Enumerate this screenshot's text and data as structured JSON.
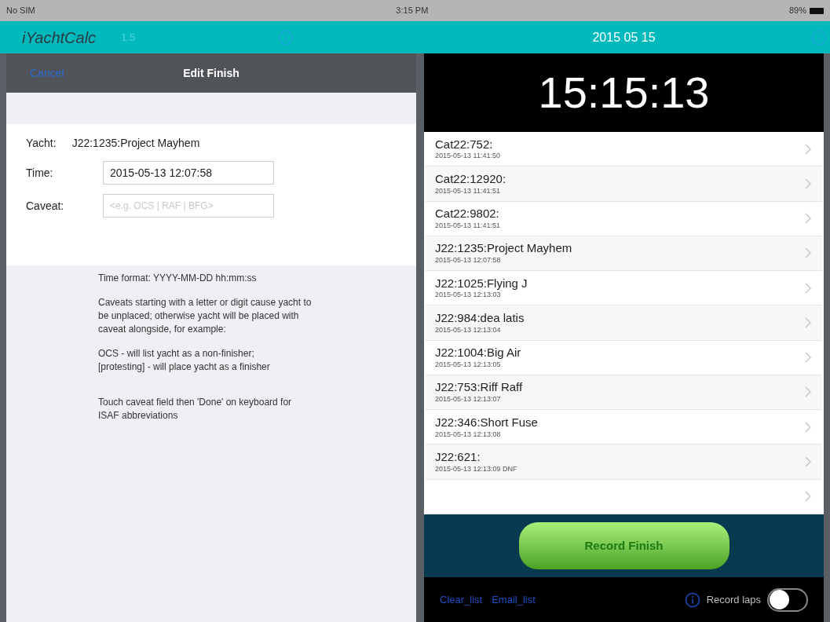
{
  "status_bar": {
    "carrier": "No SIM",
    "time": "3:15 PM",
    "battery": "89%"
  },
  "app_bar": {
    "title": "iYachtCalc",
    "version": "1.5",
    "date": "2015 05 15"
  },
  "edit_panel": {
    "cancel": "Cancel",
    "title": "Edit Finish",
    "yacht_label": "Yacht:",
    "yacht": "J22:1235:Project Mayhem",
    "time_label": "Time:",
    "time_value": "2015-05-13 12:07:58",
    "caveat_label": "Caveat:",
    "caveat_placeholder": "<e.g. OCS | RAF | BFG>",
    "notes": [
      "Time format: YYYY-MM-DD hh:mm:ss",
      "Caveats starting with a letter or digit cause yacht to be unplaced; otherwise yacht will be placed with caveat alongside, for example:",
      "OCS - will list yacht as a non-finisher;\n[protesting] - will place yacht as a finisher",
      "Touch caveat field then 'Done' on keyboard for ISAF abbreviations"
    ]
  },
  "clock": "15:15:13",
  "finishes": [
    {
      "kind": "entry",
      "name": "Cat22:752:",
      "time": "2015-05-13 11:41:50"
    },
    {
      "kind": "entry",
      "name": "Cat22:12920:",
      "time": "2015-05-13 11:41:51"
    },
    {
      "kind": "entry",
      "name": "Cat22:9802:",
      "time": "2015-05-13 11:41:51"
    },
    {
      "kind": "entry",
      "name": "J22:1235:Project Mayhem",
      "time": "2015-05-13 12:07:58"
    },
    {
      "kind": "entry",
      "name": "J22:1025:Flying J",
      "time": "2015-05-13 12:13:03"
    },
    {
      "kind": "entry",
      "name": "J22:984:dea latis",
      "time": "2015-05-13 12:13:04"
    },
    {
      "kind": "entry",
      "name": "J22:1004:Big Air",
      "time": "2015-05-13 12:13:05"
    },
    {
      "kind": "entry",
      "name": "J22:753:Riff Raff",
      "time": "2015-05-13 12:13:07"
    },
    {
      "kind": "entry",
      "name": "J22:346:Short Fuse",
      "time": "2015-05-13 12:13:08"
    },
    {
      "kind": "entry",
      "name": "J22:621:",
      "time": "2015-05-13 12:13:09 DNF"
    },
    {
      "kind": "blank"
    }
  ],
  "record_button": "Record Finish",
  "footer": {
    "clear": "Clear_list",
    "email": "Email_list",
    "laps_label": "Record laps",
    "laps_on": false
  }
}
